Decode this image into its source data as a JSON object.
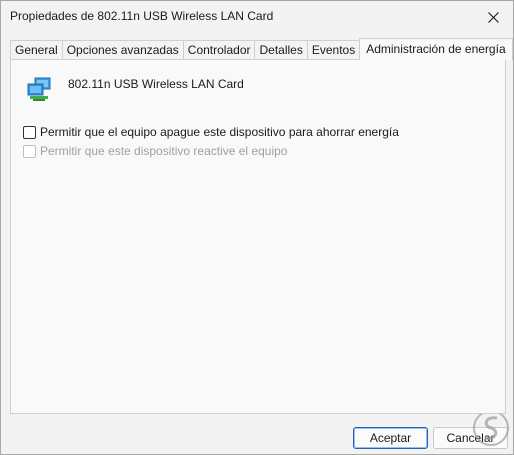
{
  "window": {
    "title": "Propiedades de 802.11n USB Wireless LAN Card"
  },
  "tabs": [
    {
      "label": "General"
    },
    {
      "label": "Opciones avanzadas"
    },
    {
      "label": "Controlador"
    },
    {
      "label": "Detalles"
    },
    {
      "label": "Eventos"
    },
    {
      "label": "Administración de energía",
      "active": true
    }
  ],
  "device": {
    "name": "802.11n USB Wireless LAN Card",
    "icon": "network-adapter-icon"
  },
  "options": {
    "allow_turn_off": {
      "label": "Permitir que el equipo apague este dispositivo para ahorrar energía",
      "checked": false,
      "enabled": true
    },
    "allow_wake": {
      "label": "Permitir que este dispositivo reactive el equipo",
      "checked": false,
      "enabled": false
    }
  },
  "buttons": {
    "ok": "Aceptar",
    "cancel": "Cancelar"
  },
  "colors": {
    "arrow": "#e8343b",
    "accent": "#1e63b8"
  }
}
